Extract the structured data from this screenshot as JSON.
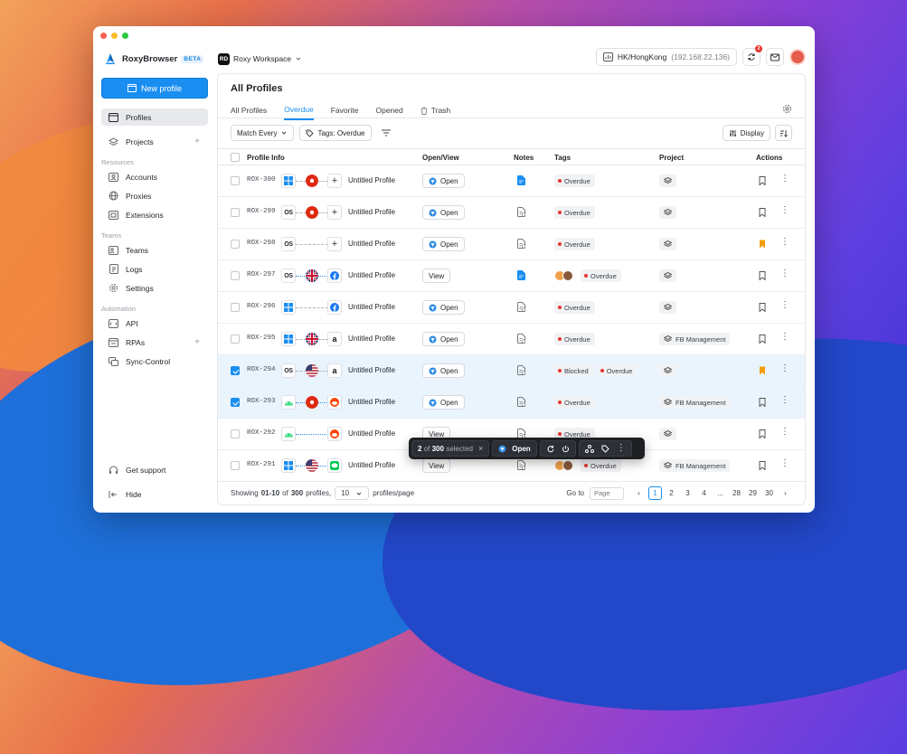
{
  "app": {
    "name": "RoxyBrowser",
    "badge": "BETA",
    "workspace_initials": "RD",
    "workspace": "Roxy Workspace"
  },
  "topbar": {
    "proxy_location": "HK/HongKong",
    "proxy_ip": "(192.168.22.136)",
    "notification_count": "2"
  },
  "sidebar": {
    "new_profile": "New profile",
    "items": {
      "profiles": "Profiles",
      "projects": "Projects",
      "accounts": "Accounts",
      "proxies": "Proxies",
      "extensions": "Extensions",
      "teams": "Teams",
      "logs": "Logs",
      "settings": "Settings",
      "api": "API",
      "rpas": "RPAs",
      "sync": "Sync-Control",
      "support": "Get support",
      "hide": "Hide"
    },
    "sections": {
      "resources": "Resources",
      "teams": "Teams",
      "automation": "Automation"
    }
  },
  "main": {
    "title": "All Profiles",
    "tabs": [
      "All Profiles",
      "Overdue",
      "Favorite",
      "Opened",
      "Trash"
    ],
    "active_tab": "Overdue",
    "filters": {
      "match": "Match Every",
      "tags": "Tags: Overdue",
      "display": "Display"
    },
    "columns": {
      "profile": "Profile Info",
      "open": "Open/View",
      "notes": "Notes",
      "tags": "Tags",
      "project": "Project",
      "actions": "Actions"
    }
  },
  "rows": [
    {
      "code": "ROX-300",
      "os": "win",
      "flag": "hk",
      "site": "+",
      "name": "Untitled Profile",
      "btn": "Open",
      "note": "blue",
      "tags": [
        "Overdue"
      ],
      "faces": false,
      "project": "",
      "bm": "none",
      "checked": false
    },
    {
      "code": "ROX-299",
      "os": "mac",
      "flag": "hk",
      "site": "+",
      "name": "Untitled Profile",
      "btn": "Open",
      "note": "grey",
      "tags": [
        "Overdue"
      ],
      "faces": false,
      "project": "",
      "bm": "none",
      "checked": false
    },
    {
      "code": "ROX-298",
      "os": "mac",
      "flag": "",
      "site": "+",
      "name": "Untitled Profile",
      "btn": "Open",
      "note": "grey",
      "tags": [
        "Overdue"
      ],
      "faces": false,
      "project": "",
      "bm": "orange",
      "checked": false
    },
    {
      "code": "ROX-297",
      "os": "mac",
      "flag": "uk",
      "site": "fb",
      "name": "Untitled Profile",
      "btn": "View",
      "note": "blue",
      "tags": [
        "Overdue"
      ],
      "faces": true,
      "project": "",
      "bm": "none",
      "checked": false
    },
    {
      "code": "ROX-296",
      "os": "win",
      "flag": "",
      "site": "fb",
      "name": "Untitled Profile",
      "btn": "Open",
      "note": "grey",
      "tags": [
        "Overdue"
      ],
      "faces": false,
      "project": "",
      "bm": "none",
      "checked": false
    },
    {
      "code": "ROX-295",
      "os": "win",
      "flag": "uk",
      "site": "amz",
      "name": "Untitled Profile",
      "btn": "Open",
      "note": "grey",
      "tags": [
        "Overdue"
      ],
      "faces": false,
      "project": "FB Management",
      "bm": "none",
      "checked": false
    },
    {
      "code": "ROX-294",
      "os": "mac",
      "flag": "us",
      "site": "amz",
      "name": "Untitled Profile",
      "btn": "Open",
      "note": "grey",
      "tags": [
        "Blocked",
        "Overdue"
      ],
      "faces": false,
      "project": "",
      "bm": "orange",
      "checked": true
    },
    {
      "code": "ROX-293",
      "os": "android",
      "flag": "hk",
      "site": "reddit",
      "name": "Untitled Profile",
      "btn": "Open",
      "note": "grey",
      "tags": [
        "Overdue"
      ],
      "faces": false,
      "project": "FB Management",
      "bm": "none",
      "checked": true
    },
    {
      "code": "ROX-292",
      "os": "android",
      "flag": "",
      "site": "reddit",
      "name": "Untitled Profile",
      "btn": "View",
      "note": "grey",
      "tags": [
        "Overdue"
      ],
      "faces": false,
      "project": "",
      "bm": "none",
      "checked": false
    },
    {
      "code": "ROX-291",
      "os": "win",
      "flag": "us",
      "site": "line",
      "name": "Untitled Profile",
      "btn": "View",
      "note": "grey",
      "tags": [
        "Overdue"
      ],
      "faces": true,
      "project": "FB Management",
      "bm": "none",
      "checked": false
    }
  ],
  "footer": {
    "showing_a": "Showing",
    "range": "01-10",
    "of": "of",
    "total": "300",
    "profiles_word": "profiles,",
    "page_size": "10",
    "per_page": "profiles/page",
    "goto": "Go to",
    "page_placeholder": "Page",
    "pages": [
      "1",
      "2",
      "3",
      "4",
      "...",
      "28",
      "29",
      "30"
    ]
  },
  "selection": {
    "count": "2",
    "of": "of",
    "total": "300",
    "selected": "selected",
    "open": "Open"
  }
}
